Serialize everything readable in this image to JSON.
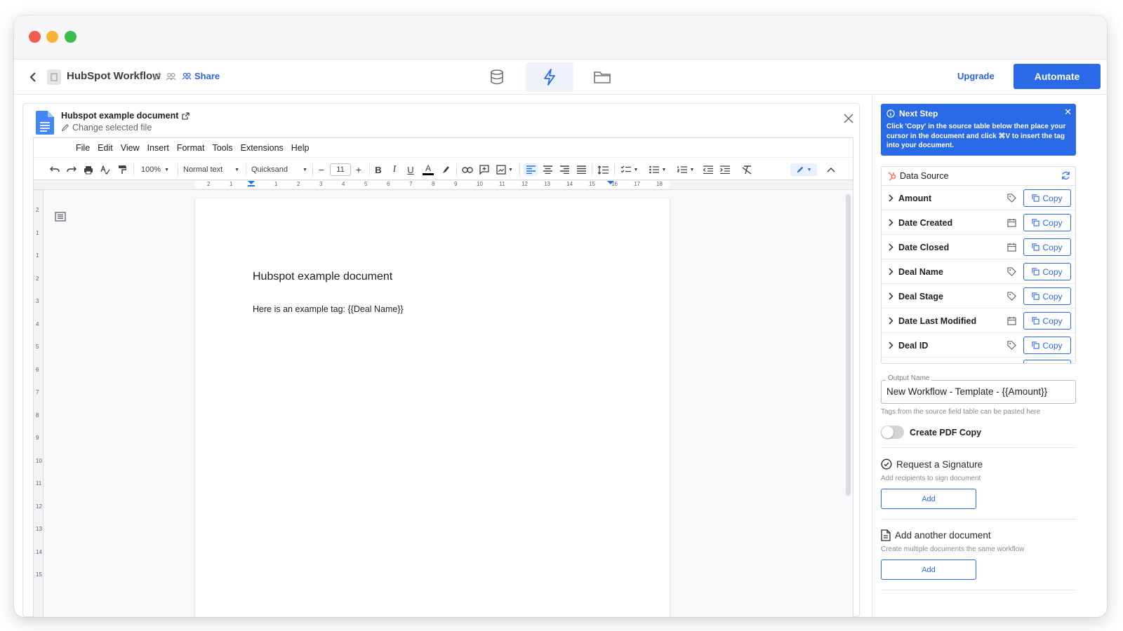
{
  "window": {
    "dots": [
      "#ee5d50",
      "#f5b731",
      "#3dbb4b"
    ]
  },
  "appbar": {
    "title": "HubSpot Workflow",
    "share_label": "Share",
    "tabs": [
      {
        "icon": "database-icon"
      },
      {
        "icon": "lightning-icon",
        "active": true
      },
      {
        "icon": "folder-icon"
      }
    ],
    "upgrade_label": "Upgrade",
    "automate_label": "Automate",
    "accent": "#2b6ae6"
  },
  "editor": {
    "file_name": "Hubspot example document",
    "change_file_label": "Change selected file",
    "menu": [
      "File",
      "Edit",
      "View",
      "Insert",
      "Format",
      "Tools",
      "Extensions",
      "Help"
    ],
    "toolbar": {
      "zoom": "100%",
      "style": "Normal text",
      "font": "Quicksand",
      "font_size": "11"
    },
    "ruler_ticks": [
      "2",
      "1",
      "1",
      "2",
      "3",
      "4",
      "5",
      "6",
      "7",
      "8",
      "9",
      "10",
      "11",
      "12",
      "13",
      "14",
      "15",
      "16",
      "17",
      "18"
    ],
    "vruler_ticks": [
      "2",
      "1",
      "1",
      "2",
      "3",
      "4",
      "5",
      "6",
      "7",
      "8",
      "9",
      "10",
      "11",
      "12",
      "13",
      "14",
      "15"
    ],
    "document": {
      "title": "Hubspot example document",
      "body": "Here is an example tag: {{Deal Name}}"
    }
  },
  "panel": {
    "next_step": {
      "title": "Next Step",
      "text": "Click 'Copy' in the source table below then place your cursor in the document and click ⌘V to insert the tag into your document."
    },
    "data_source": {
      "title": "Data Source",
      "copy_label": "Copy",
      "fields": [
        {
          "label": "Amount",
          "type_icon": "tag-icon"
        },
        {
          "label": "Date Created",
          "type_icon": "calendar-icon"
        },
        {
          "label": "Date Closed",
          "type_icon": "calendar-icon"
        },
        {
          "label": "Deal Name",
          "type_icon": "tag-icon"
        },
        {
          "label": "Deal Stage",
          "type_icon": "tag-icon"
        },
        {
          "label": "Date Last Modified",
          "type_icon": "calendar-icon"
        },
        {
          "label": "Deal ID",
          "type_icon": "tag-icon"
        }
      ]
    },
    "output": {
      "label": "Output Name",
      "value": "New Workflow - Template - {{Amount}}",
      "help": "Tags from the source field table can be pasted here"
    },
    "pdf_copy_label": "Create PDF Copy",
    "pdf_copy_enabled": false,
    "signature": {
      "title": "Request a Signature",
      "sub": "Add recipients to sign document",
      "button": "Add"
    },
    "another_doc": {
      "title": "Add another document",
      "sub": "Create multiple documents the same workflow",
      "button": "Add"
    }
  }
}
